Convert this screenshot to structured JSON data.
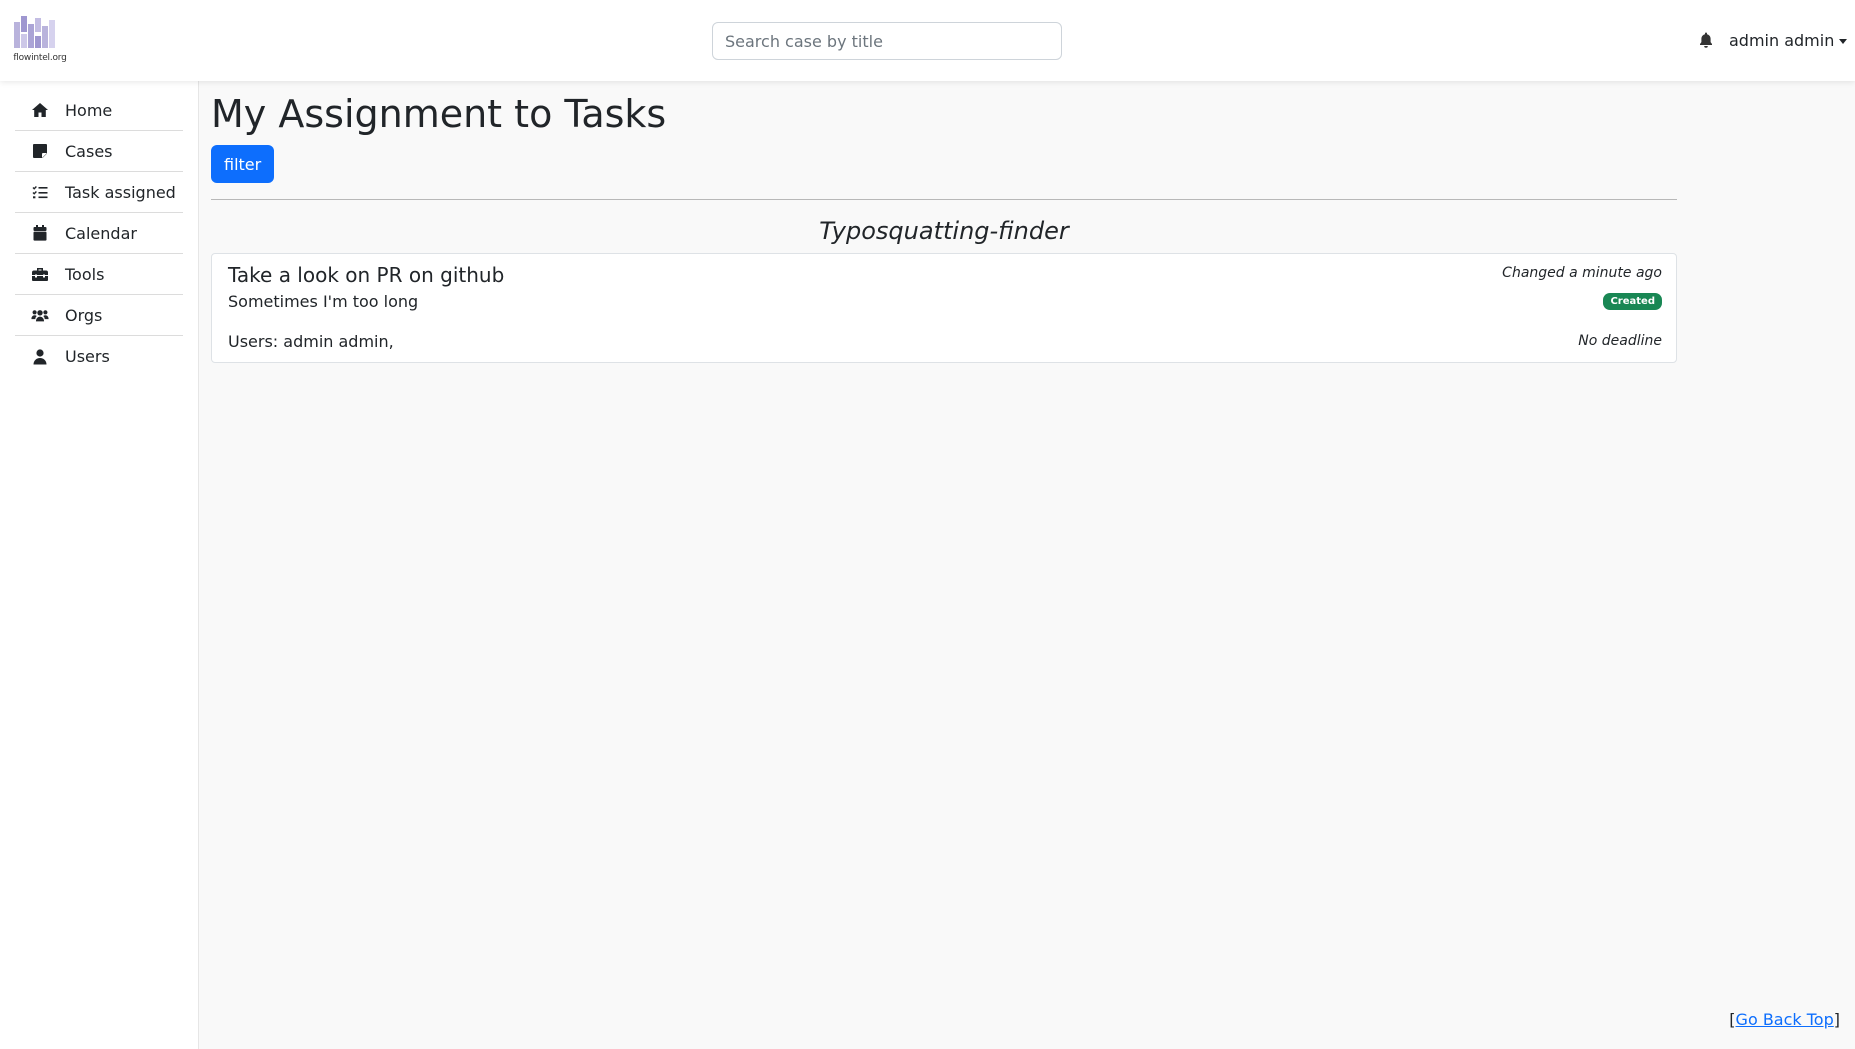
{
  "header": {
    "logo_text": "flowintel.org",
    "search_placeholder": "Search case by title",
    "search_value": "",
    "user_name": "admin admin",
    "accent_color": "#0d6efd"
  },
  "sidebar": {
    "items": [
      {
        "label": "Home",
        "icon": "home-icon"
      },
      {
        "label": "Cases",
        "icon": "sticky-note-icon"
      },
      {
        "label": "Task assigned",
        "icon": "list-check-icon"
      },
      {
        "label": "Calendar",
        "icon": "calendar-icon"
      },
      {
        "label": "Tools",
        "icon": "toolbox-icon"
      },
      {
        "label": "Orgs",
        "icon": "users-group-icon"
      },
      {
        "label": "Users",
        "icon": "user-icon"
      }
    ]
  },
  "main": {
    "title": "My Assignment to Tasks",
    "filter_label": "filter",
    "case_name": "Typosquatting-finder",
    "task": {
      "title": "Take a look on PR on github",
      "description": "Sometimes I'm too long",
      "users": "Users: admin admin,",
      "changed": "Changed a minute ago",
      "status": "Created",
      "status_color": "#198754",
      "deadline": "No deadline"
    }
  },
  "footer": {
    "back_top_open": "[",
    "back_top_label": "Go Back Top",
    "back_top_close": "]"
  }
}
